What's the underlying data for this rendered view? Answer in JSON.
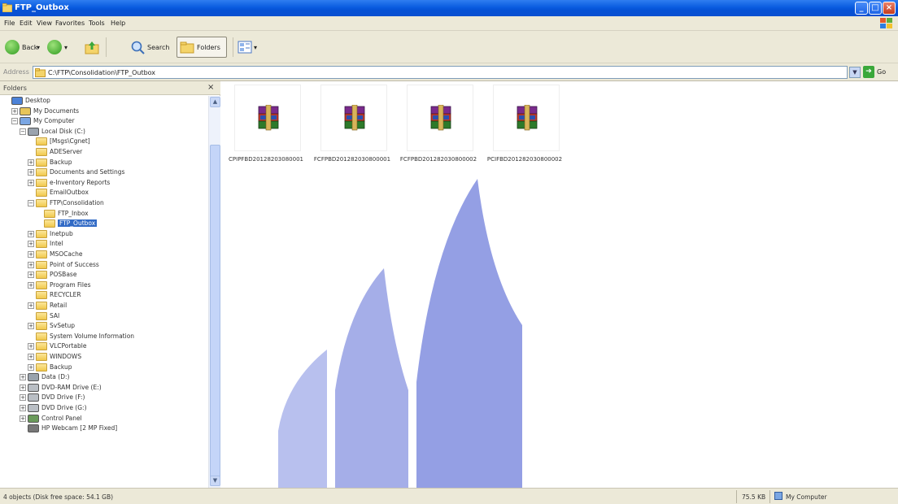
{
  "window": {
    "title": "FTP_Outbox"
  },
  "menu": [
    "File",
    "Edit",
    "View",
    "Favorites",
    "Tools",
    "Help"
  ],
  "toolbar": {
    "back": "Back",
    "search": "Search",
    "folders": "Folders"
  },
  "address": {
    "label": "Address",
    "path": "C:\\FTP\\Consolidation\\FTP_Outbox",
    "go": "Go"
  },
  "folders_pane": {
    "title": "Folders",
    "tree": [
      {
        "label": "Desktop",
        "icon": "desktop-icon",
        "expander": ""
      },
      {
        "label": "My Documents",
        "icon": "documents-icon",
        "expander": "+"
      },
      {
        "label": "My Computer",
        "icon": "computer-icon",
        "expander": "−"
      },
      {
        "label": "Local Disk (C:)",
        "icon": "drive-icon",
        "expander": "−"
      },
      {
        "label": "[Msgs\\Cgnet]",
        "icon": "folder-icon",
        "expander": ""
      },
      {
        "label": "ADEServer",
        "icon": "folder-icon",
        "expander": ""
      },
      {
        "label": "Backup",
        "icon": "folder-icon",
        "expander": "+"
      },
      {
        "label": "Documents and Settings",
        "icon": "folder-icon",
        "expander": "+"
      },
      {
        "label": "e-Inventory Reports",
        "icon": "folder-icon",
        "expander": "+"
      },
      {
        "label": "EmailOutbox",
        "icon": "folder-icon",
        "expander": ""
      },
      {
        "label": "FTP\\Consolidation",
        "icon": "folder-icon",
        "expander": "−"
      },
      {
        "label": "FTP_Inbox",
        "icon": "folder-icon",
        "expander": ""
      },
      {
        "label": "FTP_Outbox",
        "icon": "folder-icon",
        "expander": "",
        "selected": true
      },
      {
        "label": "Inetpub",
        "icon": "folder-icon",
        "expander": "+"
      },
      {
        "label": "Intel",
        "icon": "folder-icon",
        "expander": "+"
      },
      {
        "label": "MSOCache",
        "icon": "folder-icon",
        "expander": "+"
      },
      {
        "label": "Point of Success",
        "icon": "folder-icon",
        "expander": "+"
      },
      {
        "label": "POSBase",
        "icon": "folder-icon",
        "expander": "+"
      },
      {
        "label": "Program Files",
        "icon": "folder-icon",
        "expander": "+"
      },
      {
        "label": "RECYCLER",
        "icon": "folder-icon",
        "expander": ""
      },
      {
        "label": "Retail",
        "icon": "folder-icon",
        "expander": "+"
      },
      {
        "label": "SAI",
        "icon": "folder-icon",
        "expander": ""
      },
      {
        "label": "SvSetup",
        "icon": "folder-icon",
        "expander": "+"
      },
      {
        "label": "System Volume Information",
        "icon": "folder-icon",
        "expander": ""
      },
      {
        "label": "VLCPortable",
        "icon": "folder-icon",
        "expander": "+"
      },
      {
        "label": "WINDOWS",
        "icon": "folder-icon",
        "expander": "+"
      },
      {
        "label": "Backup",
        "icon": "folder-icon",
        "expander": "+"
      },
      {
        "label": "Data (D:)",
        "icon": "drive-icon",
        "expander": "+"
      },
      {
        "label": "DVD-RAM Drive (E:)",
        "icon": "dvd-icon",
        "expander": "+"
      },
      {
        "label": "DVD Drive (F:)",
        "icon": "dvd-icon",
        "expander": "+"
      },
      {
        "label": "DVD Drive (G:)",
        "icon": "dvd-icon",
        "expander": "+"
      },
      {
        "label": "Control Panel",
        "icon": "control-panel-icon",
        "expander": "+"
      },
      {
        "label": "HP Webcam [2 MP Fixed]",
        "icon": "webcam-icon",
        "expander": ""
      }
    ]
  },
  "files": [
    {
      "name": "CPIPFBD20128203080001",
      "icon": "winrar-archive-icon"
    },
    {
      "name": "FCFPBD201282030800001",
      "icon": "winrar-archive-icon"
    },
    {
      "name": "FCFPBD201282030800002",
      "icon": "winrar-archive-icon"
    },
    {
      "name": "PCIFBD201282030800002",
      "icon": "winrar-archive-icon"
    }
  ],
  "status": {
    "left": "4 objects (Disk free space: 54.1 GB)",
    "size": "75.5 KB",
    "location": "My Computer"
  },
  "colors": {
    "titlebar": "#0a5ce0",
    "chrome": "#ece9d8",
    "selection": "#316ac5",
    "watermark": "#5a6bd6"
  }
}
